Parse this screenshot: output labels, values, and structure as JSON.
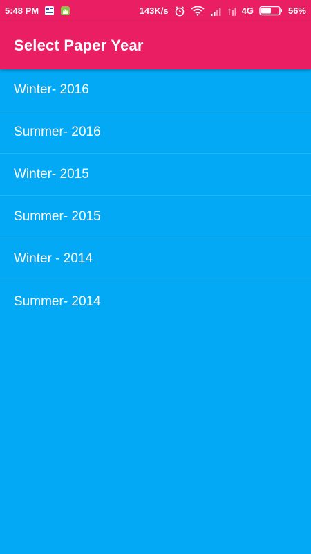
{
  "status_bar": {
    "time": "5:48 PM",
    "network_speed": "143K/s",
    "network_type": "4G",
    "battery_percent": "56%",
    "battery_level": 0.56,
    "icons": [
      "notification-app-icon",
      "android-app-icon",
      "alarm-icon",
      "wifi-icon",
      "signal-icon",
      "signal-secondary-icon",
      "battery-icon"
    ]
  },
  "app_bar": {
    "title": "Select Paper Year"
  },
  "years": [
    {
      "label": "Winter- 2016"
    },
    {
      "label": "Summer- 2016"
    },
    {
      "label": "Winter- 2015"
    },
    {
      "label": "Summer- 2015"
    },
    {
      "label": "Winter - 2014"
    },
    {
      "label": "Summer- 2014"
    }
  ],
  "colors": {
    "primary": "#E91E63",
    "background": "#03A9F4",
    "text": "#FFFFFF"
  }
}
